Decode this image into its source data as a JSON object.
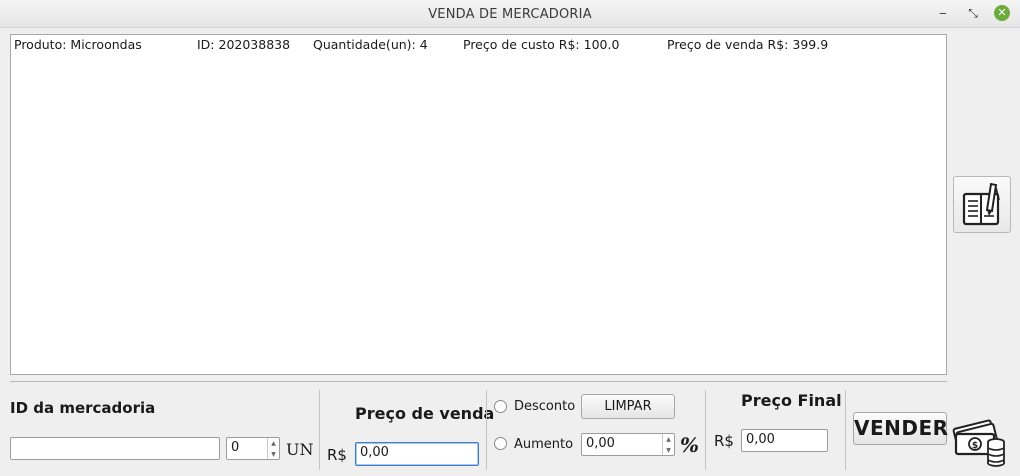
{
  "window": {
    "title": "VENDA DE MERCADORIA",
    "minimize_glyph": "‒",
    "maximize_glyph": "⤡",
    "close_glyph": "✕"
  },
  "list": {
    "rows": [
      {
        "produto": "Produto: Microondas",
        "id": "ID: 202038838",
        "quantidade": "Quantidade(un): 4",
        "preco_custo": "Preço de custo R$: 100.0",
        "preco_venda": "Preço de venda R$: 399.9"
      }
    ]
  },
  "side_button": {
    "icon": "ledger-book-pen-icon"
  },
  "id_section": {
    "title": "ID da mercadoria",
    "id_value": "",
    "qty_value": "0",
    "unit_label": "UN"
  },
  "price_section": {
    "title": "Preço de venda",
    "currency": "R$",
    "value": "0,00"
  },
  "adjust_section": {
    "desconto_label": "Desconto",
    "aumento_label": "Aumento",
    "limpar_label": "LIMPAR",
    "percent_value": "0,00",
    "percent_symbol": "%"
  },
  "final_section": {
    "title": "Preço Final",
    "currency": "R$",
    "value": "0,00"
  },
  "vender": {
    "label": "VENDER",
    "icon": "money-coins-icon"
  }
}
